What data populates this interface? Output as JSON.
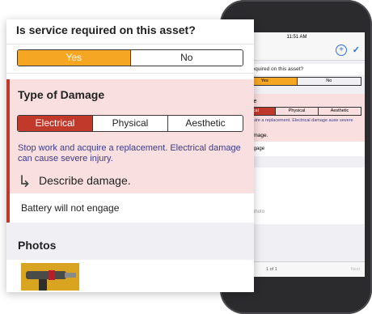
{
  "form": {
    "service_question": "Is service required on this asset?",
    "service_options": [
      "Yes",
      "No"
    ],
    "service_selected": "Yes",
    "damage_title": "Type of Damage",
    "damage_options": [
      "Electrical",
      "Physical",
      "Aesthetic"
    ],
    "damage_selected": "Electrical",
    "warning": "Stop work and acquire a replacement. Electrical damage can cause severe injury.",
    "describe_label": "Describe damage.",
    "describe_value": "Battery will not engage",
    "photos_title": "Photos"
  },
  "phone": {
    "time": "11:51 AM",
    "question": "service required on this asset?",
    "yes": "Yes",
    "no": "No",
    "damage_title": "f Damage",
    "seg_electrical": "trical",
    "seg_physical": "Physical",
    "seg_aesthetic": "Aesthetic",
    "warning": "rk and acquire a replacement. Electrical damage ause severe injury.",
    "describe": "scribe damage.",
    "value": "will not engage",
    "tap_hint": "p to select photo",
    "page": "1 of 1",
    "next": "Next"
  },
  "colors": {
    "accent_yes": "#f5a623",
    "accent_damage": "#c0392b",
    "damage_bg": "#f9dfdf",
    "warning_text": "#3b3b8a"
  }
}
